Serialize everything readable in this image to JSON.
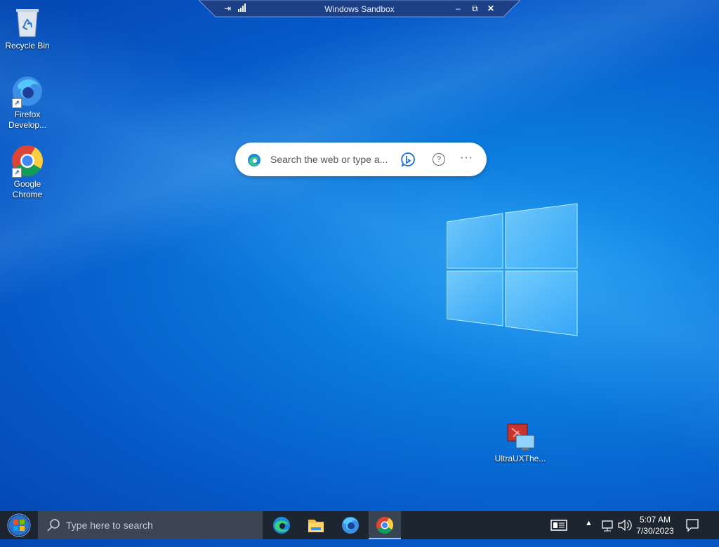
{
  "sandbox": {
    "title": "Windows Sandbox"
  },
  "desktop_icons": [
    {
      "label": "Recycle Bin",
      "icon": "recycle-bin-icon"
    },
    {
      "label": "Firefox Develop...",
      "label_line1": "Firefox",
      "label_line2": "Develop...",
      "icon": "firefox-developer-icon"
    },
    {
      "label_line1": "Google",
      "label_line2": "Chrome",
      "icon": "chrome-icon"
    },
    {
      "label": "UltraUXThe...",
      "icon": "ultrauxthemepatcher-icon"
    }
  ],
  "search_widget": {
    "placeholder": "Search the web or type a...",
    "help_glyph": "?",
    "more_glyph": "···"
  },
  "taskbar": {
    "search_placeholder": "Type here to search",
    "apps": [
      "edge-icon",
      "file-explorer-icon",
      "firefox-icon",
      "chrome-icon"
    ],
    "active_app": "chrome-icon",
    "time": "5:07 AM",
    "date": "7/30/2023"
  },
  "colors": {
    "desktop": "#0a78dc",
    "taskbar": "#1c2530",
    "taskbar_search": "#3b4553"
  }
}
